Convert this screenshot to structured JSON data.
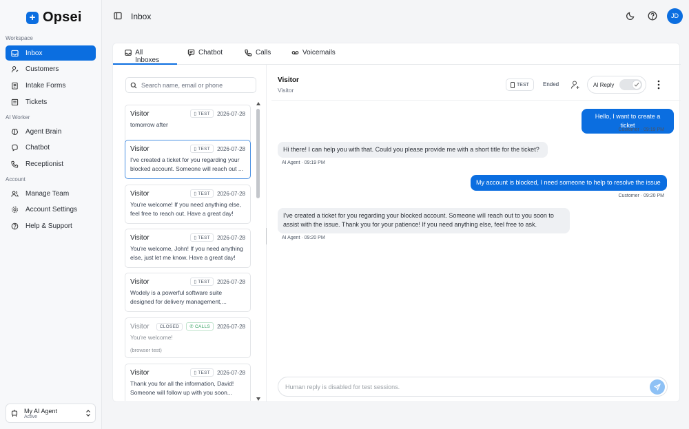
{
  "app": {
    "name": "Opsei",
    "logo_glyph": "+"
  },
  "sidebar": {
    "sections": [
      {
        "label": "Workspace"
      },
      {
        "label": "AI Worker"
      },
      {
        "label": "Account"
      }
    ],
    "items": [
      {
        "label": "Inbox",
        "icon": "inbox-icon"
      },
      {
        "label": "Customers",
        "icon": "user-icon"
      },
      {
        "label": "Intake Forms",
        "icon": "clipboard-icon"
      },
      {
        "label": "Tickets",
        "icon": "ticket-icon"
      },
      {
        "label": "Agent Brain",
        "icon": "brain-icon"
      },
      {
        "label": "Chatbot",
        "icon": "chat-icon"
      },
      {
        "label": "Receptionist",
        "icon": "phone-icon"
      },
      {
        "label": "Manage Team",
        "icon": "team-icon"
      },
      {
        "label": "Account Settings",
        "icon": "gear-icon"
      },
      {
        "label": "Help & Support",
        "icon": "help-icon"
      }
    ],
    "agent": {
      "name": "My AI Agent",
      "status": "Active"
    }
  },
  "header": {
    "title": "Inbox",
    "avatar_initials": "JD"
  },
  "tabs": [
    {
      "label": "All Inboxes"
    },
    {
      "label": "Chatbot"
    },
    {
      "label": "Calls"
    },
    {
      "label": "Voicemails"
    }
  ],
  "search": {
    "placeholder": "Search name, email or phone"
  },
  "conversations": [
    {
      "name": "Visitor",
      "badge": "TEST",
      "date": "2026-07-28",
      "preview": "tomorrow after"
    },
    {
      "name": "Visitor",
      "badge": "TEST",
      "date": "2026-07-28",
      "preview": "I've created a ticket for you regarding your blocked account. Someone will reach out ..."
    },
    {
      "name": "Visitor",
      "badge": "TEST",
      "date": "2026-07-28",
      "preview": "You're welcome! If you need anything else, feel free to reach out. Have a great day!"
    },
    {
      "name": "Visitor",
      "badge": "TEST",
      "date": "2026-07-28",
      "preview": "You're welcome, John! If you need anything else, just let me know. Have a great day!"
    },
    {
      "name": "Visitor",
      "badge": "TEST",
      "date": "2026-07-28",
      "preview": "Wodely is a powerful software suite designed for delivery management,..."
    },
    {
      "name": "Visitor",
      "badge": "CLOSED",
      "badge2": "CALLS",
      "date": "2026-07-28",
      "preview": "You're welcome!",
      "note": "(browser test)"
    },
    {
      "name": "Visitor",
      "badge": "TEST",
      "date": "2026-07-28",
      "preview": "Thank you for all the information, David! Someone will follow up with you soon..."
    }
  ],
  "chat": {
    "name": "Visitor",
    "subtitle": "Visitor",
    "test_label": "TEST",
    "status": "Ended",
    "ai_reply_label": "AI Reply",
    "ai_reply_enabled": false,
    "messages": [
      {
        "from": "out",
        "text": "Hello, I want to create a ticket",
        "meta": "Customer · 09:19 PM"
      },
      {
        "from": "in",
        "text": "Hi there! I can help you with that. Could you please provide me with a short title for the ticket?",
        "meta": "AI Agent · 09:19 PM"
      },
      {
        "from": "out",
        "text": "My account is blocked, I need someone to help to resolve the issue",
        "meta": "Customer · 09:20 PM"
      },
      {
        "from": "in",
        "text": "I've created a ticket for you regarding your blocked account. Someone will reach out to you soon to assist with the issue. Thank you for your patience! If you need anything else, feel free to ask.",
        "meta": "AI Agent · 09:20 PM"
      }
    ],
    "composer_placeholder": "Human reply is disabled for test sessions."
  },
  "colors": {
    "accent": "#0b6ee0",
    "send_disabled": "#8ec1f5"
  }
}
